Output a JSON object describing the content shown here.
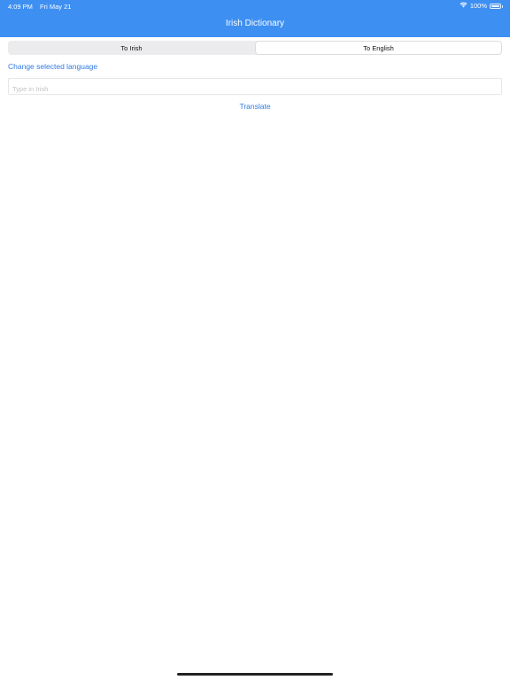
{
  "status_bar": {
    "time": "4:09 PM",
    "date": "Fri May 21",
    "battery_percent": "100%",
    "icons": [
      "wifi-icon",
      "battery-icon"
    ]
  },
  "nav": {
    "title": "Irish Dictionary",
    "background_color": "#3d8ff2"
  },
  "segments": {
    "items": [
      {
        "label": "To Irish"
      },
      {
        "label": "To English"
      }
    ],
    "selected_index": 1
  },
  "change_language_label": "Change selected language",
  "search": {
    "placeholder": "Type in Irish",
    "value": ""
  },
  "translate_label": "Translate",
  "accent_color": "#2f7ae5"
}
